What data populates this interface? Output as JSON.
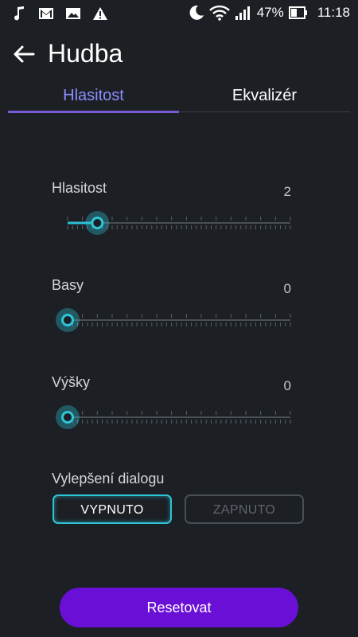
{
  "status_bar": {
    "notification_icons": [
      "music-note-icon",
      "gmail-icon",
      "image-icon",
      "warning-icon"
    ],
    "system_icons": [
      "moon-icon",
      "wifi-icon",
      "signal-icon",
      "battery-icon"
    ],
    "battery": "47%",
    "time": "11:18"
  },
  "header": {
    "title": "Hudba"
  },
  "tabs": [
    {
      "label": "Hlasitost",
      "active": true
    },
    {
      "label": "Ekvalizér",
      "active": false
    }
  ],
  "sliders": [
    {
      "label": "Hlasitost",
      "value": "2",
      "level": 2,
      "max": 15
    },
    {
      "label": "Basy",
      "value": "0",
      "level": 0,
      "max": 15
    },
    {
      "label": "Výšky",
      "value": "0",
      "level": 0,
      "max": 15
    }
  ],
  "dialog": {
    "label": "Vylepšení dialogu",
    "off_label": "VYPNUTO",
    "on_label": "ZAPNUTO",
    "selected": "VYPNUTO"
  },
  "reset_label": "Resetovat",
  "colors": {
    "background": "#1c1f24",
    "accent_tab": "#8c8cff",
    "slider_accent": "#2ec4d7",
    "reset_button": "#6a0fd6"
  }
}
